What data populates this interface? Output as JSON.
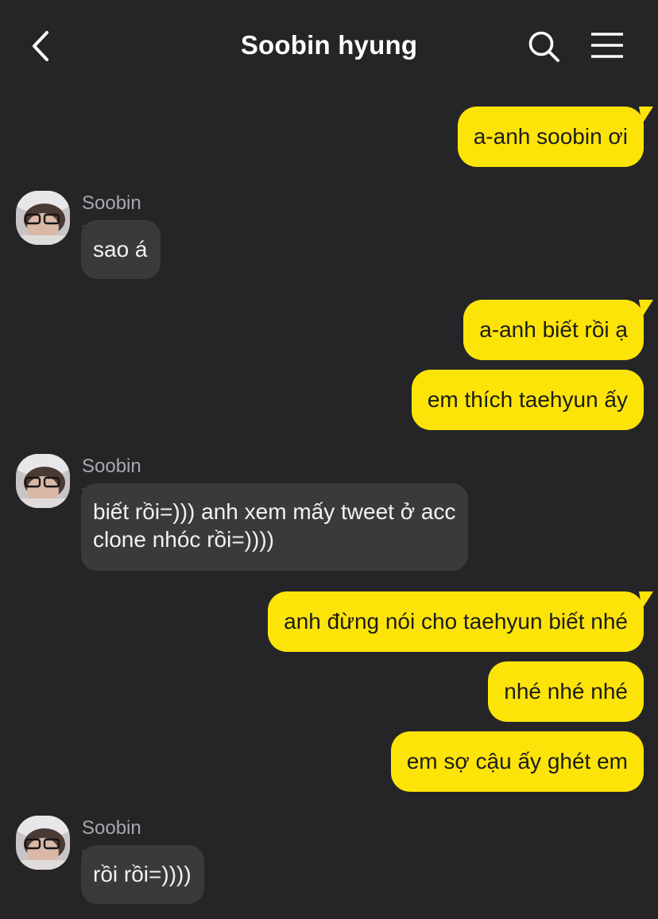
{
  "header": {
    "title": "Soobin hyung",
    "back_icon": "chevron-left-icon",
    "search_icon": "search-icon",
    "menu_icon": "hamburger-menu-icon"
  },
  "colors": {
    "background": "#252528",
    "outgoing_bubble": "#fde408",
    "incoming_bubble": "#3a3a3d"
  },
  "messages": [
    {
      "from": "me",
      "text": "a-anh soobin ơi"
    },
    {
      "from": "Soobin",
      "sender": "Soobin",
      "text": "sao á"
    },
    {
      "from": "me",
      "text": "a-anh biết rồi ạ"
    },
    {
      "from": "me",
      "text": "em thích taehyun ấy"
    },
    {
      "from": "Soobin",
      "sender": "Soobin",
      "lines": [
        "biết rồi=))) anh xem mấy tweet ở acc",
        "clone nhóc rồi=))))"
      ]
    },
    {
      "from": "me",
      "text": "anh đừng nói cho taehyun biết nhé"
    },
    {
      "from": "me",
      "text": "nhé nhé nhé"
    },
    {
      "from": "me",
      "text": "em sợ cậu ấy ghét em"
    },
    {
      "from": "Soobin",
      "sender": "Soobin",
      "text": "rồi rồi=))))"
    }
  ]
}
